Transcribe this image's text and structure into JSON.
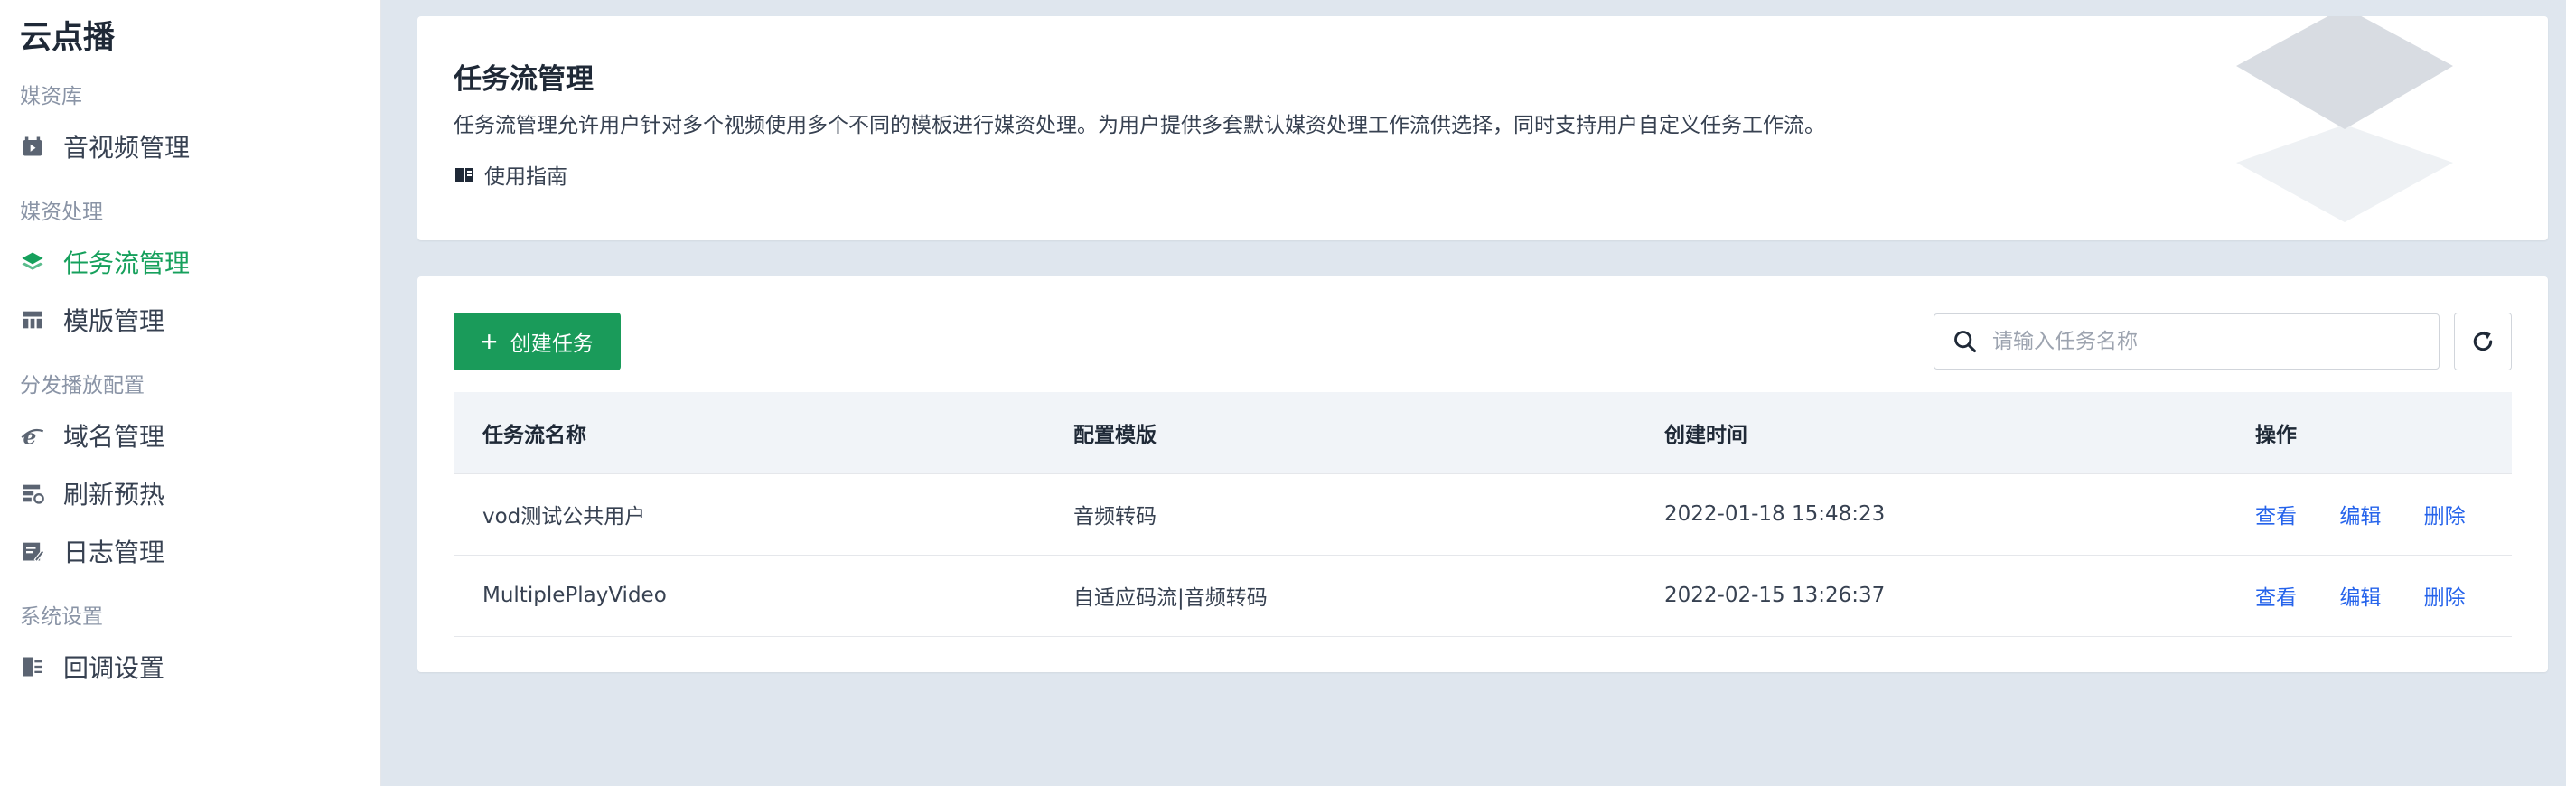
{
  "app": {
    "title": "云点播"
  },
  "sidebar": {
    "groups": [
      {
        "title": "媒资库",
        "items": [
          {
            "label": "音视频管理",
            "icon": "media-icon"
          }
        ]
      },
      {
        "title": "媒资处理",
        "items": [
          {
            "label": "任务流管理",
            "icon": "layers-icon",
            "active": true
          },
          {
            "label": "模版管理",
            "icon": "template-icon"
          }
        ]
      },
      {
        "title": "分发播放配置",
        "items": [
          {
            "label": "域名管理",
            "icon": "domain-icon"
          },
          {
            "label": "刷新预热",
            "icon": "refresh-cache-icon"
          },
          {
            "label": "日志管理",
            "icon": "log-icon"
          }
        ]
      },
      {
        "title": "系统设置",
        "items": [
          {
            "label": "回调设置",
            "icon": "callback-icon"
          }
        ]
      }
    ]
  },
  "intro": {
    "title": "任务流管理",
    "desc": "任务流管理允许用户针对多个视频使用多个不同的模板进行媒资处理。为用户提供多套默认媒资处理工作流供选择，同时支持用户自定义任务工作流。",
    "guide_label": "使用指南"
  },
  "toolbar": {
    "create_label": "创建任务",
    "search_placeholder": "请输入任务名称"
  },
  "table": {
    "headers": [
      "任务流名称",
      "配置模版",
      "创建时间",
      "操作"
    ],
    "rows": [
      {
        "name": "vod测试公共用户",
        "template": "音频转码",
        "created": "2022-01-18 15:48:23"
      },
      {
        "name": "MultiplePlayVideo",
        "template": "自适应码流|音频转码",
        "created": "2022-02-15 13:26:37"
      }
    ],
    "actions": {
      "view": "查看",
      "edit": "编辑",
      "delete": "删除"
    }
  },
  "colors": {
    "accent": "#16a05c",
    "button": "#1a9b5a",
    "link": "#2563eb",
    "background": "#dfe6ee"
  }
}
